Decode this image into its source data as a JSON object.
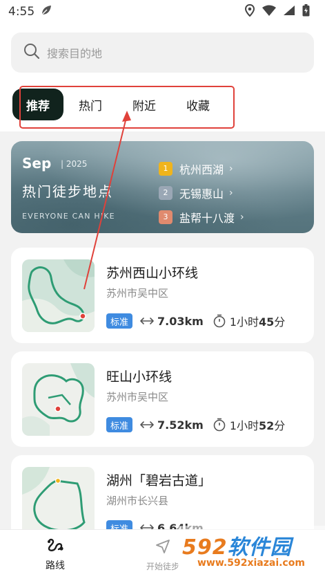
{
  "status": {
    "time": "4:55"
  },
  "search": {
    "placeholder": "搜索目的地"
  },
  "tabs": [
    {
      "label": "推荐",
      "active": true
    },
    {
      "label": "热门",
      "active": false
    },
    {
      "label": "附近",
      "active": false
    },
    {
      "label": "收藏",
      "active": false
    }
  ],
  "banner": {
    "month": "Sep",
    "year": "2025",
    "title": "热门徒步地点",
    "subtitle": "EVERYONE CAN HIKE",
    "ranks": [
      {
        "num": "1",
        "name": "杭州西湖",
        "color": "#f0b41c"
      },
      {
        "num": "2",
        "name": "无锡惠山",
        "color": "#9aa7b5"
      },
      {
        "num": "3",
        "name": "盐帮十八渡",
        "color": "#e08a6e"
      }
    ]
  },
  "routes": [
    {
      "title": "苏州西山小环线",
      "location": "苏州市吴中区",
      "tag": "标准",
      "distance": "7.03km",
      "duration_pre": "1小时",
      "duration_num": "45",
      "duration_post": "分"
    },
    {
      "title": "旺山小环线",
      "location": "苏州市吴中区",
      "tag": "标准",
      "distance": "7.52km",
      "duration_pre": "1小时",
      "duration_num": "52",
      "duration_post": "分"
    },
    {
      "title": "湖州「碧岩古道」",
      "location": "湖州市长兴县",
      "tag": "标准",
      "distance": "6.64km",
      "duration_pre": "",
      "duration_num": "",
      "duration_post": ""
    }
  ],
  "nav": [
    {
      "label": "路线",
      "icon": "route-icon"
    },
    {
      "label": "开始徒步",
      "icon": "navigation-icon"
    }
  ],
  "watermark": {
    "logo_a": "592",
    "logo_b": "软件园",
    "url": "www.592xiazai.com"
  },
  "colors": {
    "accent": "#11231d",
    "tag": "#3f8be0",
    "annotation": "#e0413a",
    "route_line": "#2e9c74"
  }
}
